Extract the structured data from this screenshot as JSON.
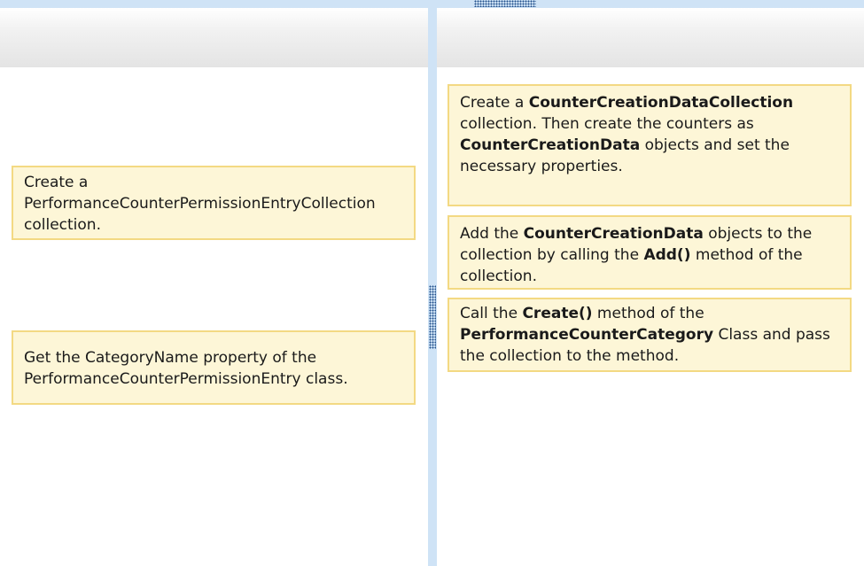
{
  "source_panel": {
    "items": [
      {
        "text": "Create a PerformanceCounterPermissionEntryCollection collection."
      },
      {
        "text": "Get the CategoryName property of the PerformanceCounterPermissionEntry class."
      }
    ]
  },
  "answer_panel": {
    "items": [
      {
        "t1": "Create a ",
        "b1": "CounterCreationDataCollection",
        "t2": " collection. Then create the counters as ",
        "b2": "CounterCreationData",
        "t3": " objects and set the necessary properties."
      },
      {
        "t1": "Add the ",
        "b1": "CounterCreationData",
        "t2": " objects to the collection by calling the ",
        "b2": "Add()",
        "t3": " method of the collection."
      },
      {
        "t1": "Call the ",
        "b1": "Create()",
        "t2": " method of the ",
        "b2": "PerformanceCounterCategory",
        "t3": " Class and pass the collection to the method."
      }
    ]
  },
  "colors": {
    "card_background": "#fdf6d7",
    "card_border": "#f3d983",
    "splitter": "#cfe3f6",
    "grip_dots": "#1f4e8a"
  }
}
